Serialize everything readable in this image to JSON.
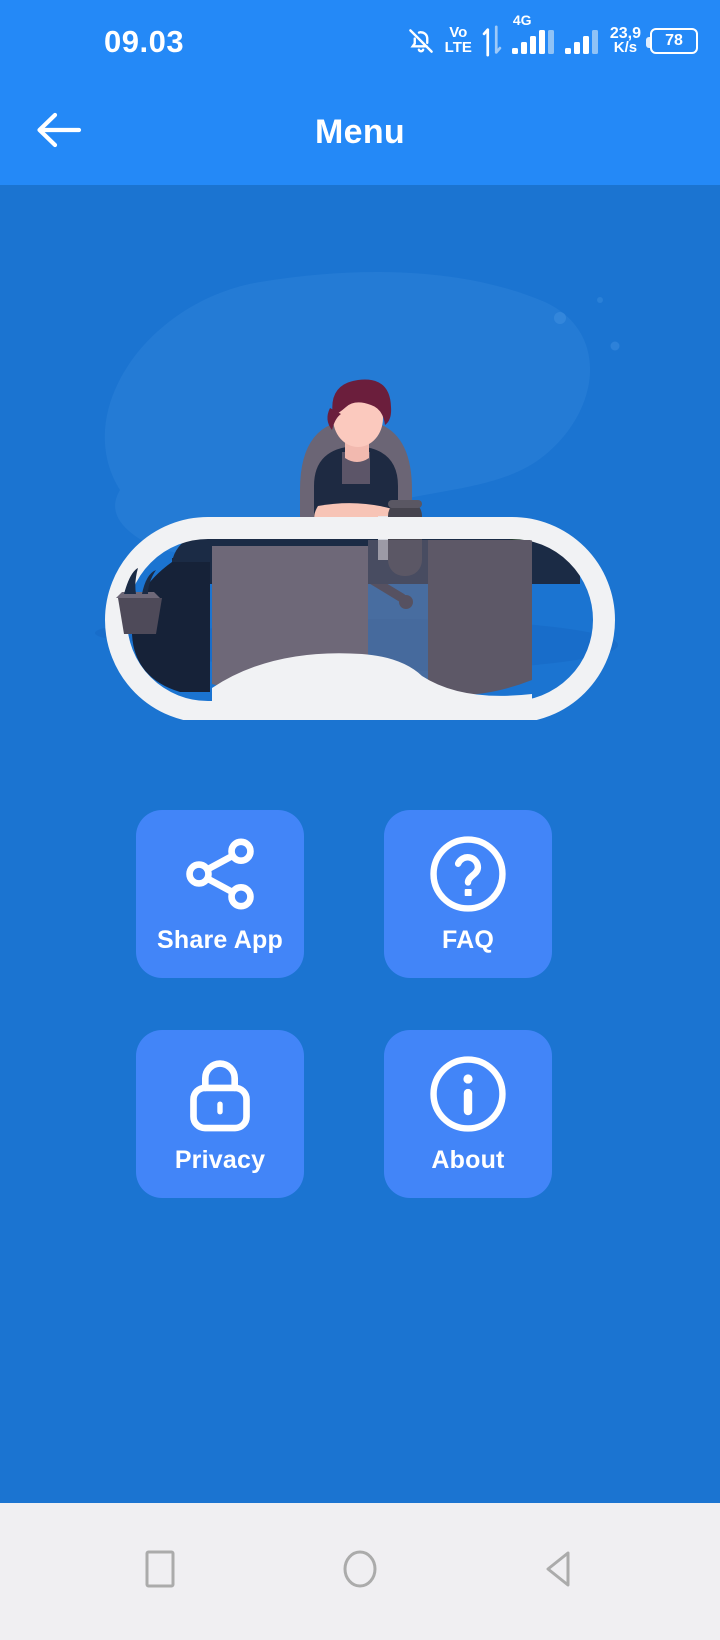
{
  "statusbar": {
    "time": "09.03",
    "volte_line1": "Vo",
    "volte_line2": "LTE",
    "network_type": "4G",
    "data_rate_value": "23,9",
    "data_rate_unit": "K/s",
    "battery_level": "78",
    "icons": [
      "bell-muted-icon",
      "volte-icon",
      "data-transfer-icon",
      "signal-bars-icon",
      "signal-bars-secondary-icon",
      "battery-icon"
    ]
  },
  "appbar": {
    "title": "Menu",
    "back_icon": "arrow-left-icon"
  },
  "illustration": {
    "name": "person-at-desk-illustration",
    "alt": "Illustration of a person sitting at an oval desk with a speaker, laptop and plant"
  },
  "menu": {
    "items": [
      {
        "id": "share-app",
        "label": "Share App",
        "icon": "share-icon"
      },
      {
        "id": "faq",
        "label": "FAQ",
        "icon": "question-circle-icon"
      },
      {
        "id": "privacy",
        "label": "Privacy",
        "icon": "lock-icon"
      },
      {
        "id": "about",
        "label": "About",
        "icon": "info-circle-icon"
      }
    ]
  },
  "navbar": {
    "buttons": [
      {
        "id": "recents",
        "icon": "square-icon"
      },
      {
        "id": "home",
        "icon": "circle-icon"
      },
      {
        "id": "back",
        "icon": "triangle-left-icon"
      }
    ]
  },
  "colors": {
    "statusbar_bg": "#2489F7",
    "appbar_bg": "#2489F7",
    "content_bg": "#1B74D1",
    "card_bg": "#4285F8",
    "navbar_bg": "#F0EFF2",
    "nav_icon": "#ABABAB",
    "text_on_blue": "#FFFFFF"
  }
}
